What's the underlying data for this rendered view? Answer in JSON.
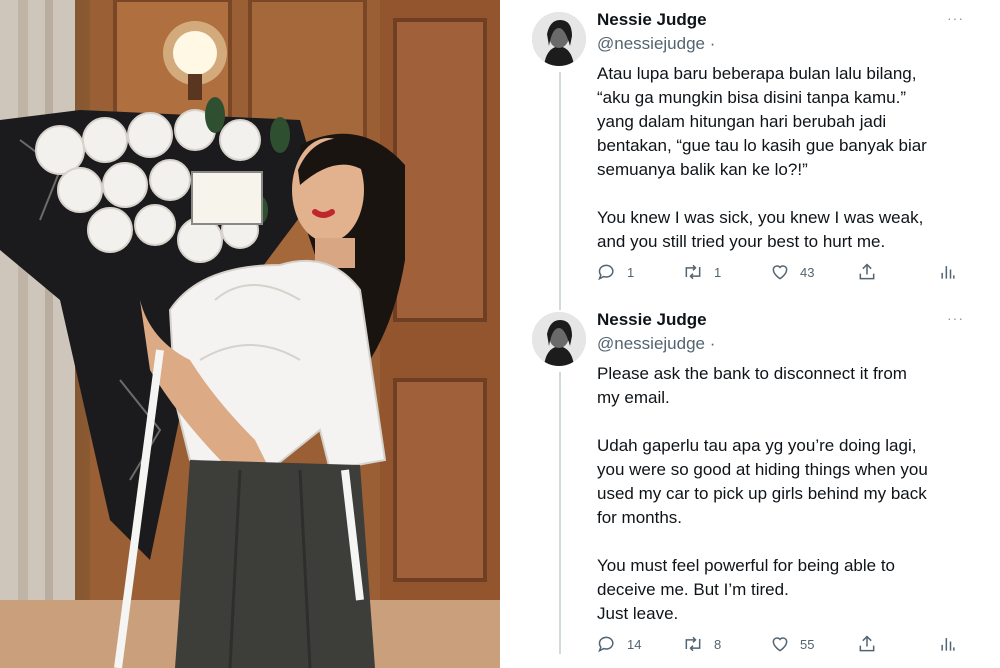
{
  "tweets": [
    {
      "author_name": "Nessie Judge",
      "author_handle": "@nessiejudge",
      "handle_separator": "·",
      "more_icon": "···",
      "paragraphs": [
        "Atau lupa baru beberapa bulan lalu bilang,\n“aku ga mungkin bisa disini tanpa kamu.”\nyang dalam hitungan hari berubah jadi\nbentakan, “gue tau lo kasih gue banyak biar\nsemuanya balik kan ke lo?!”",
        "You knew I was sick, you knew I was weak,\nand you still tried your best to hurt me."
      ],
      "reply_count": "1",
      "retweet_count": "1",
      "like_count": "43"
    },
    {
      "author_name": "Nessie Judge",
      "author_handle": "@nessiejudge",
      "handle_separator": "·",
      "more_icon": "···",
      "paragraphs": [
        "Please ask the bank to disconnect it from\nmy email.",
        "Udah gaperlu tau apa yg you’re doing lagi,\nyou were so good at hiding things when you\nused my car to pick up girls behind my back\nfor months.",
        "You must feel powerful for being able to\ndeceive me. But I’m tired.\nJust leave."
      ],
      "reply_count": "14",
      "retweet_count": "8",
      "like_count": "55"
    }
  ],
  "icons": {
    "reply": "reply-icon",
    "retweet": "retweet-icon",
    "like": "heart-icon",
    "share": "share-icon",
    "analytics": "analytics-icon"
  },
  "colors": {
    "text_primary": "#0f1419",
    "text_secondary": "#536471",
    "thread_line": "#cfd9de"
  }
}
